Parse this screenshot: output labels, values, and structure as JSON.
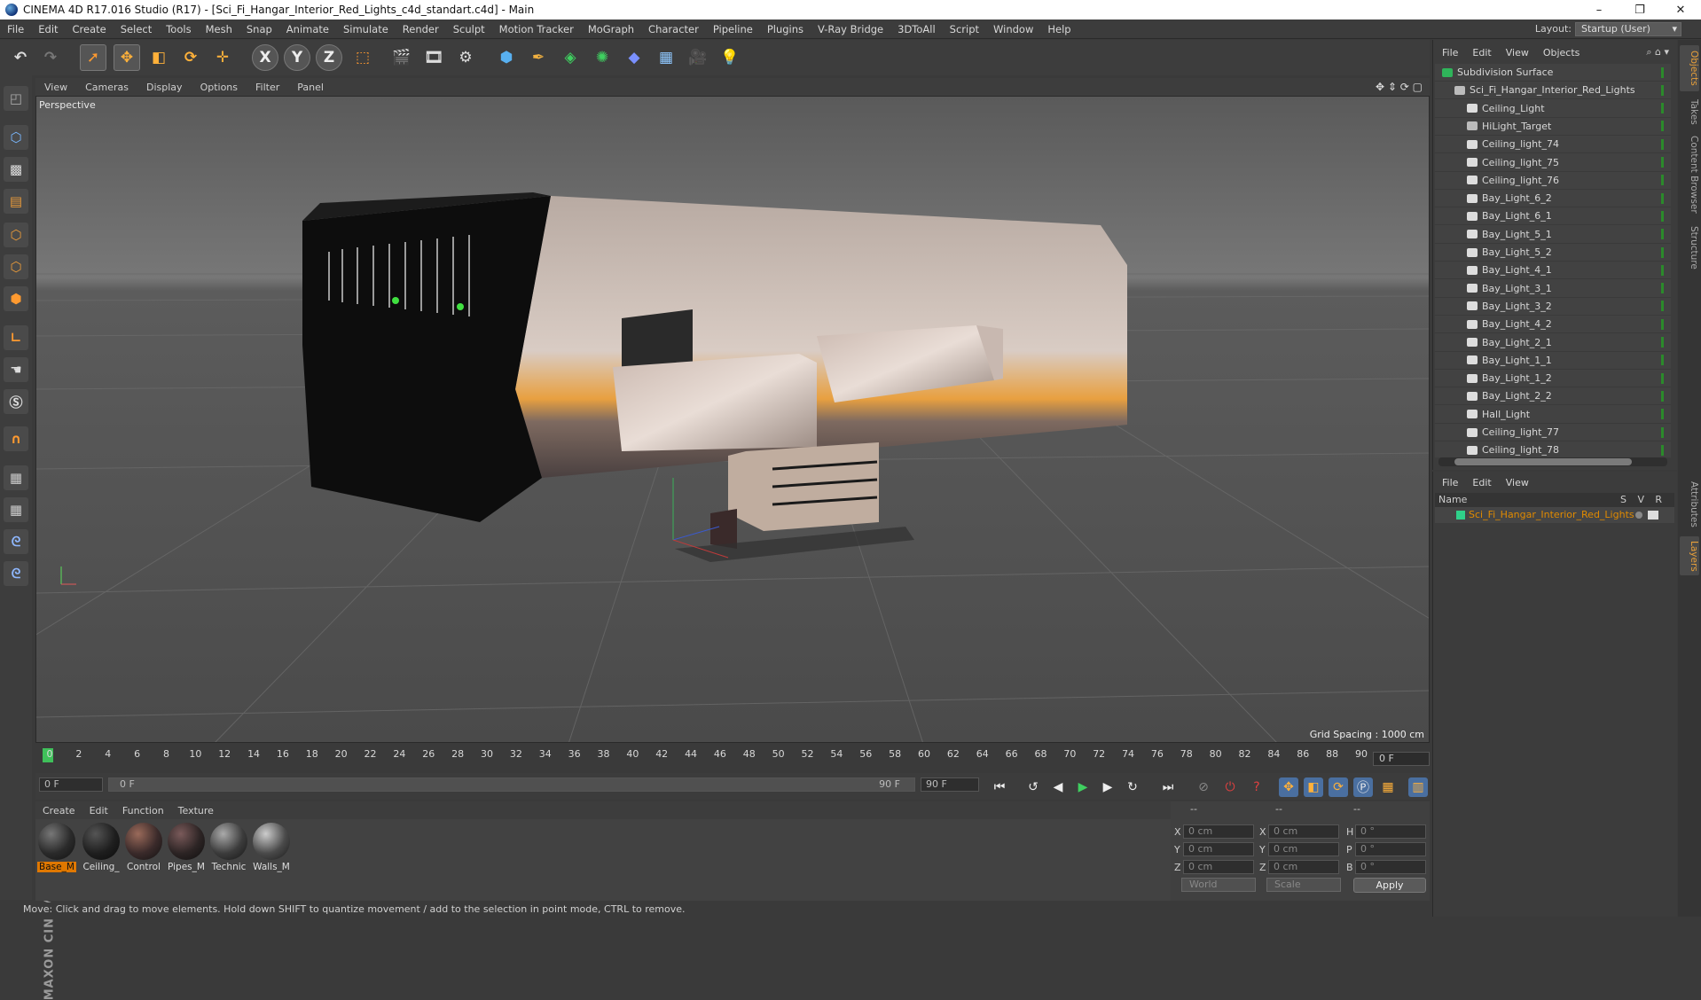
{
  "window": {
    "title": "CINEMA 4D R17.016 Studio (R17) - [Sci_Fi_Hangar_Interior_Red_Lights_c4d_standart.c4d] - Main",
    "minimize": "–",
    "maximize": "❐",
    "close": "✕"
  },
  "menubar": {
    "items": [
      "File",
      "Edit",
      "Create",
      "Select",
      "Tools",
      "Mesh",
      "Snap",
      "Animate",
      "Simulate",
      "Render",
      "Sculpt",
      "Motion Tracker",
      "MoGraph",
      "Character",
      "Pipeline",
      "Plugins",
      "V-Ray Bridge",
      "3DToAll",
      "Script",
      "Window",
      "Help"
    ],
    "layout_label": "Layout:",
    "layout_value": "Startup (User)"
  },
  "toolbar": {
    "icons": [
      "undo-icon",
      "redo-icon",
      "select-icon",
      "move-icon",
      "scale-icon",
      "rotate-icon",
      "live-select-icon",
      "x-axis-icon",
      "y-axis-icon",
      "z-axis-icon",
      "coord-system-icon",
      "render-view-icon",
      "render-picture-viewer-icon",
      "edit-render-settings-icon",
      "cube-icon",
      "pen-icon",
      "subdivision-icon",
      "cloner-icon",
      "deformer-icon",
      "floor-icon",
      "camera-icon",
      "light-icon"
    ],
    "x_label": "X",
    "y_label": "Y",
    "z_label": "Z"
  },
  "viewport": {
    "menu": [
      "View",
      "Cameras",
      "Display",
      "Options",
      "Filter",
      "Panel"
    ],
    "label": "Perspective",
    "grid_spacing": "Grid Spacing : 1000 cm"
  },
  "timeline": {
    "ticks": [
      "0",
      "2",
      "4",
      "6",
      "8",
      "10",
      "12",
      "14",
      "16",
      "18",
      "20",
      "22",
      "24",
      "26",
      "28",
      "30",
      "32",
      "34",
      "36",
      "38",
      "40",
      "42",
      "44",
      "46",
      "48",
      "50",
      "52",
      "54",
      "56",
      "58",
      "60",
      "62",
      "64",
      "66",
      "68",
      "70",
      "72",
      "74",
      "76",
      "78",
      "80",
      "82",
      "84",
      "86",
      "88",
      "90"
    ],
    "current_frame": "0 F",
    "start_field": "0 F",
    "range_start": "0 F",
    "range_end": "90 F",
    "end_field": "90 F"
  },
  "materials": {
    "menu": [
      "Create",
      "Edit",
      "Function",
      "Texture"
    ],
    "items": [
      {
        "name": "Base_M",
        "color": "#2a2a2a",
        "selected": true
      },
      {
        "name": "Ceiling_",
        "color": "#1e1e1e",
        "selected": false
      },
      {
        "name": "Control",
        "color": "#3a2a2a",
        "selected": false
      },
      {
        "name": "Pipes_M",
        "color": "#2c2424",
        "selected": false
      },
      {
        "name": "Technic",
        "color": "#3c3c3c",
        "selected": false
      },
      {
        "name": "Walls_M",
        "color": "#4a4a4a",
        "selected": false
      }
    ]
  },
  "coordinates": {
    "header": [
      "--",
      "--",
      "--"
    ],
    "rows": [
      {
        "a": "X",
        "a_val": "0 cm",
        "b": "X",
        "b_val": "0 cm",
        "c": "H",
        "c_val": "0 °"
      },
      {
        "a": "Y",
        "a_val": "0 cm",
        "b": "Y",
        "b_val": "0 cm",
        "c": "P",
        "c_val": "0 °"
      },
      {
        "a": "Z",
        "a_val": "0 cm",
        "b": "Z",
        "b_val": "0 cm",
        "c": "B",
        "c_val": "0 °"
      }
    ],
    "mode": "World",
    "transform": "Scale",
    "apply": "Apply"
  },
  "statusbar": {
    "text": "Move: Click and drag to move elements. Hold down SHIFT to quantize movement / add to the selection in point mode, CTRL to remove."
  },
  "objects": {
    "menu": [
      "File",
      "Edit",
      "View",
      "Objects"
    ],
    "items": [
      {
        "name": "Subdivision Surface",
        "indent": 0,
        "icon": "#2fb45a"
      },
      {
        "name": "Sci_Fi_Hangar_Interior_Red_Lights",
        "indent": 1,
        "icon": "#bbbbbb"
      },
      {
        "name": "Ceiling_Light",
        "indent": 2,
        "icon": "#dddddd"
      },
      {
        "name": "HiLight_Target",
        "indent": 2,
        "icon": "#bbbbbb"
      },
      {
        "name": "Ceiling_light_74",
        "indent": 2,
        "icon": "#dddddd"
      },
      {
        "name": "Ceiling_light_75",
        "indent": 2,
        "icon": "#dddddd"
      },
      {
        "name": "Ceiling_light_76",
        "indent": 2,
        "icon": "#dddddd"
      },
      {
        "name": "Bay_Light_6_2",
        "indent": 2,
        "icon": "#dddddd"
      },
      {
        "name": "Bay_Light_6_1",
        "indent": 2,
        "icon": "#dddddd"
      },
      {
        "name": "Bay_Light_5_1",
        "indent": 2,
        "icon": "#dddddd"
      },
      {
        "name": "Bay_Light_5_2",
        "indent": 2,
        "icon": "#dddddd"
      },
      {
        "name": "Bay_Light_4_1",
        "indent": 2,
        "icon": "#dddddd"
      },
      {
        "name": "Bay_Light_3_1",
        "indent": 2,
        "icon": "#dddddd"
      },
      {
        "name": "Bay_Light_3_2",
        "indent": 2,
        "icon": "#dddddd"
      },
      {
        "name": "Bay_Light_4_2",
        "indent": 2,
        "icon": "#dddddd"
      },
      {
        "name": "Bay_Light_2_1",
        "indent": 2,
        "icon": "#dddddd"
      },
      {
        "name": "Bay_Light_1_1",
        "indent": 2,
        "icon": "#dddddd"
      },
      {
        "name": "Bay_Light_1_2",
        "indent": 2,
        "icon": "#dddddd"
      },
      {
        "name": "Bay_Light_2_2",
        "indent": 2,
        "icon": "#dddddd"
      },
      {
        "name": "Hall_Light",
        "indent": 2,
        "icon": "#dddddd"
      },
      {
        "name": "Ceiling_light_77",
        "indent": 2,
        "icon": "#dddddd"
      },
      {
        "name": "Ceiling_light_78",
        "indent": 2,
        "icon": "#dddddd"
      }
    ]
  },
  "layers": {
    "menu": [
      "File",
      "Edit",
      "View"
    ],
    "header_name": "Name",
    "header_flags": [
      "S",
      "V",
      "R"
    ],
    "row": "Sci_Fi_Hangar_Interior_Red_Lights",
    "row_color": "#2fd08a"
  },
  "side_tabs": [
    "Objects",
    "Takes",
    "Content Browser",
    "Structure",
    "Attributes",
    "Layers"
  ],
  "colors": {
    "accent": "#e07800",
    "active_tab": "#e8a03a"
  }
}
